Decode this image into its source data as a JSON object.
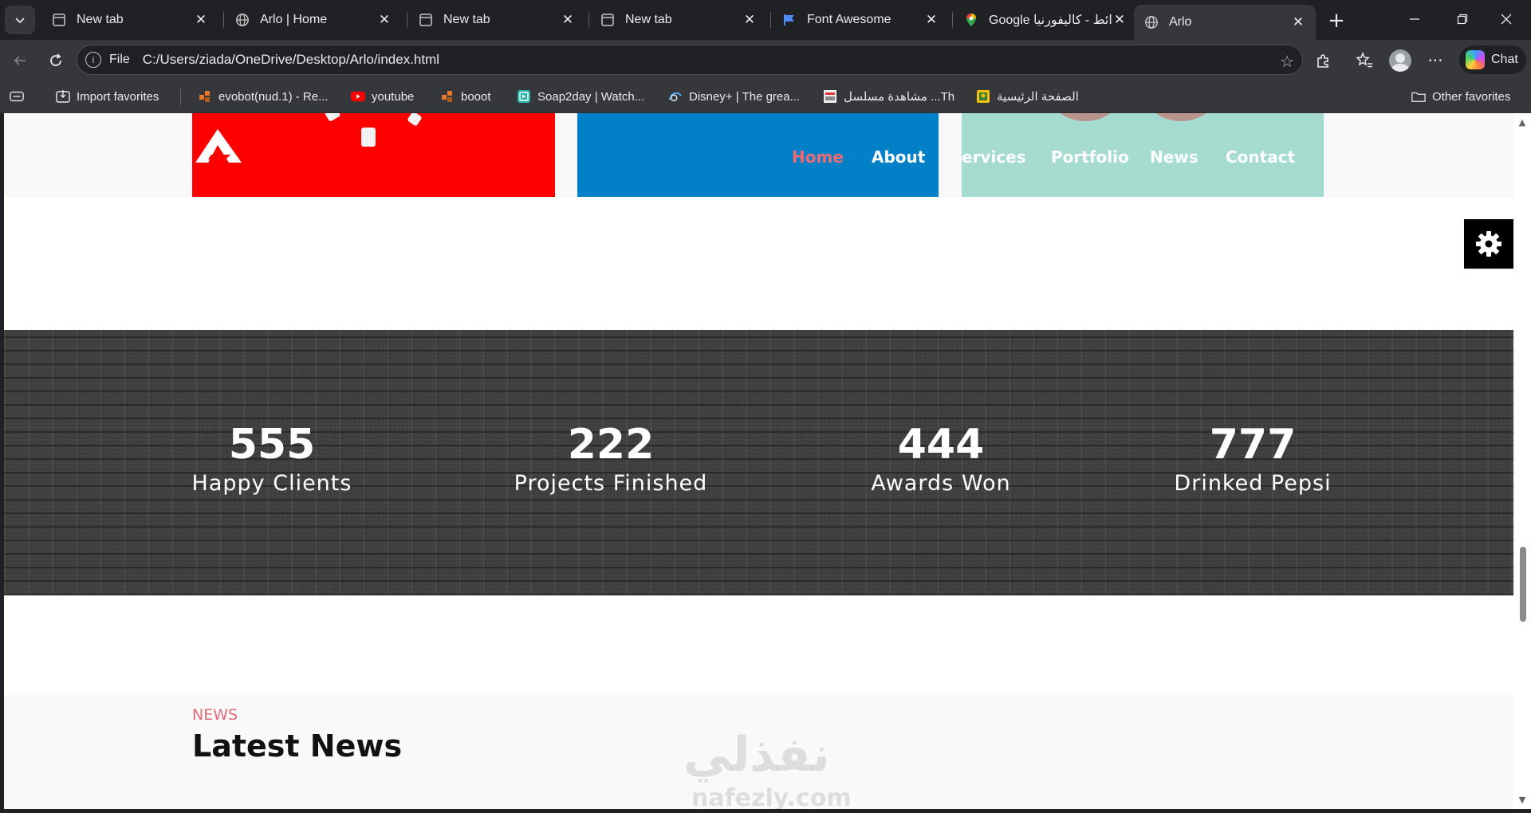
{
  "tabs": [
    {
      "title": "New tab",
      "icon": "page-icon"
    },
    {
      "title": "Arlo | Home",
      "icon": "globe-icon"
    },
    {
      "title": "New tab",
      "icon": "page-icon"
    },
    {
      "title": "New tab",
      "icon": "page-icon"
    },
    {
      "title": "Font Awesome",
      "icon": "flag-icon"
    },
    {
      "title": "Google خرائط - كاليفورنيا",
      "icon": "maps-pin-icon"
    },
    {
      "title": "Arlo",
      "icon": "globe-icon",
      "active": true
    }
  ],
  "address_bar": {
    "scheme_label": "File",
    "url": "C:/Users/ziada/OneDrive/Desktop/Arlo/index.html"
  },
  "toolbar": {
    "chat_label": "Chat"
  },
  "bookmarks": [
    {
      "label": "Import favorites",
      "icon": "import-icon"
    },
    {
      "label": "evobot(nud.1) - Re...",
      "icon": "evobot-icon"
    },
    {
      "label": "youtube",
      "icon": "youtube-icon"
    },
    {
      "label": "booot",
      "icon": "evobot-icon"
    },
    {
      "label": "Soap2day | Watch...",
      "icon": "soap2day-icon"
    },
    {
      "label": "Disney+ | The grea...",
      "icon": "disney-icon"
    },
    {
      "label": "مشاهدة مسلسل ...Th",
      "icon": "site-icon"
    },
    {
      "label": "الصفحة الرئيسية",
      "icon": "site-icon"
    },
    {
      "label": "Other favorites",
      "icon": "folder-icon"
    }
  ],
  "site_nav": [
    {
      "label": "Home",
      "active": true
    },
    {
      "label": "About"
    },
    {
      "label": "ervices"
    },
    {
      "label": "Portfolio"
    },
    {
      "label": "News"
    },
    {
      "label": "Contact"
    }
  ],
  "stats": [
    {
      "value": "555",
      "label": "Happy Clients"
    },
    {
      "value": "222",
      "label": "Projects Finished"
    },
    {
      "value": "444",
      "label": "Awards Won"
    },
    {
      "value": "777",
      "label": "Drinked Pepsi"
    }
  ],
  "news": {
    "kicker": "NEWS",
    "title": "Latest News"
  },
  "watermark": {
    "arabic": "نفذلي",
    "domain": "nafezly.com"
  },
  "colors": {
    "accent_pink": "#ef6b73",
    "card_red": "#fe0000",
    "card_blue": "#0180c7",
    "card_mint": "#a6dccf",
    "stats_bg": "#3e3e3e"
  }
}
